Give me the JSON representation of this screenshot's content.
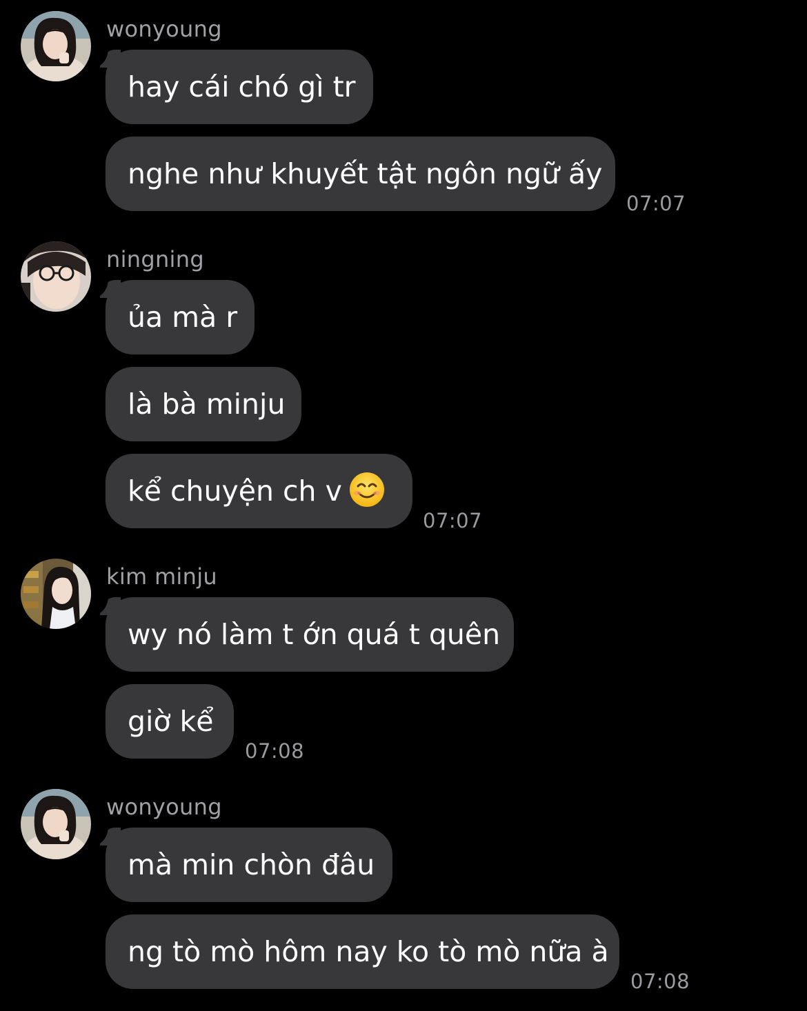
{
  "colors": {
    "background": "#000000",
    "bubble": "#38383a",
    "sender_name": "#a0a0a5",
    "timestamp": "#9a9a9f",
    "message_text": "#ffffff"
  },
  "messages": [
    {
      "sender": "wonyoung",
      "avatar": "avatar-photo-wonyoung",
      "bubbles": [
        "hay cái chó gì tr",
        "nghe như khuyết tật ngôn ngữ ấy"
      ],
      "time": "07:07"
    },
    {
      "sender": "ningning",
      "avatar": "avatar-photo-ningning",
      "bubbles": [
        "ủa mà r",
        "là bà minju",
        "kể chuyện ch v"
      ],
      "emoji": "smiling-face-emoji",
      "time": "07:07"
    },
    {
      "sender": "kim minju",
      "avatar": "avatar-photo-kim-minju",
      "bubbles": [
        "wy nó làm t ớn quá t quên",
        "giờ kể"
      ],
      "time": "07:08"
    },
    {
      "sender": "wonyoung",
      "avatar": "avatar-photo-wonyoung",
      "bubbles": [
        "mà min chòn đâu",
        "ng tò mò hôm nay ko tò mò nữa à"
      ],
      "time": "07:08"
    }
  ]
}
